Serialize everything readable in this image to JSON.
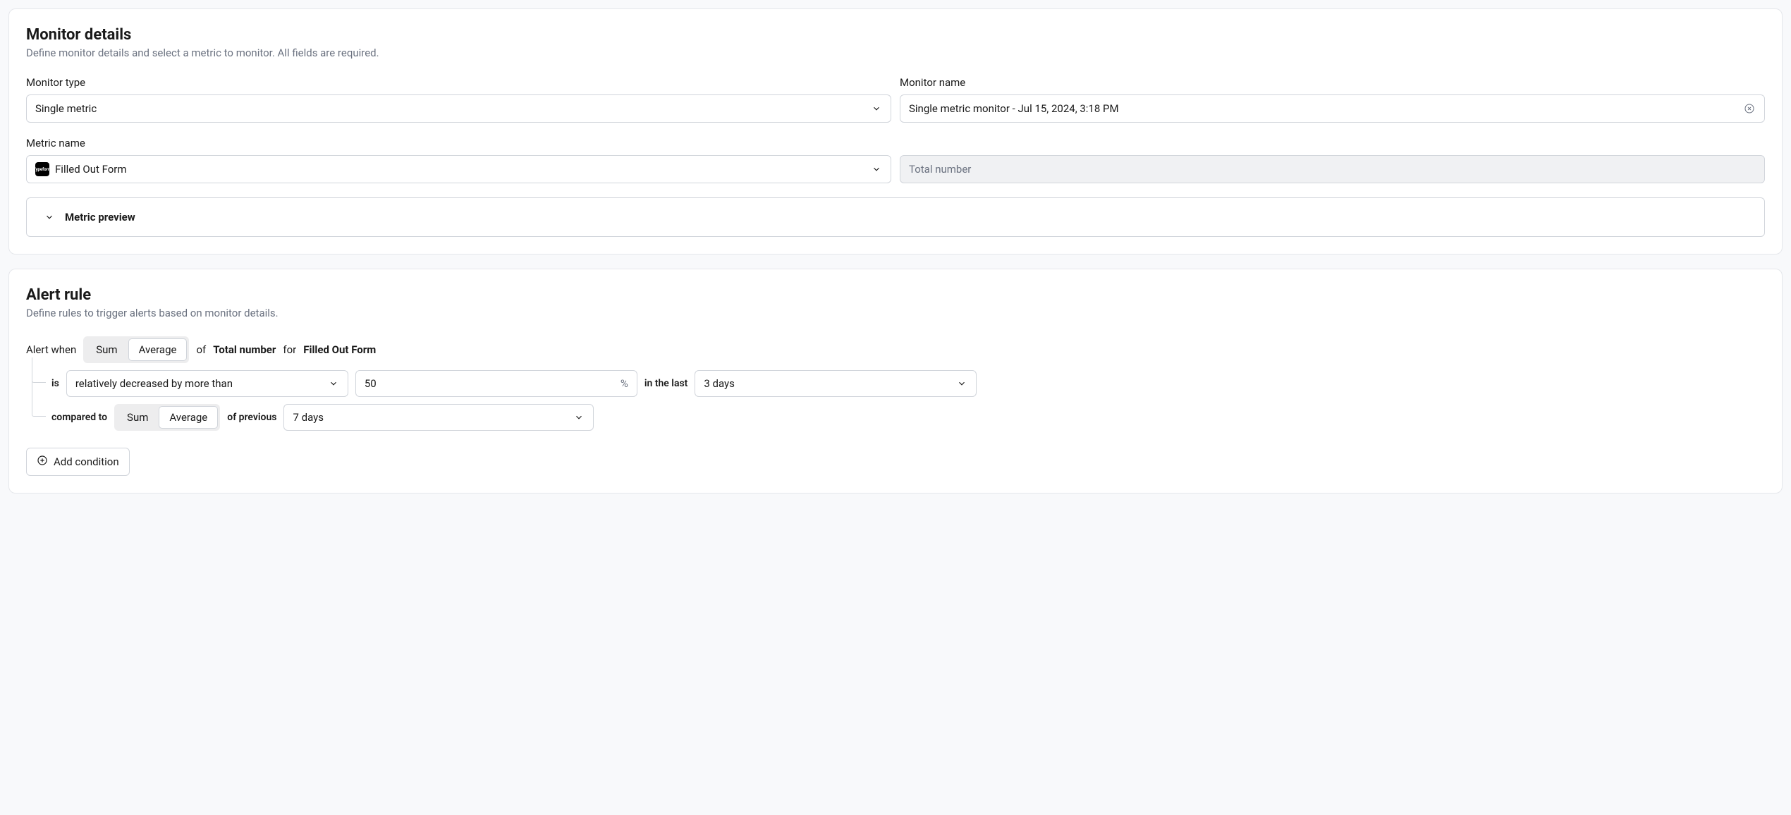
{
  "monitor_details": {
    "title": "Monitor details",
    "desc": "Define monitor details and select a metric to monitor. All fields are required.",
    "monitor_type_label": "Monitor type",
    "monitor_type_value": "Single metric",
    "monitor_name_label": "Monitor name",
    "monitor_name_value": "Single metric monitor - Jul 15, 2024, 3:18 PM",
    "metric_name_label": "Metric name",
    "metric_name_value": "Filled Out Form",
    "metric_agg_value": "Total number",
    "metric_preview_label": "Metric preview"
  },
  "alert_rule": {
    "title": "Alert rule",
    "desc": "Define rules to trigger alerts based on monitor details.",
    "alert_when": "Alert when",
    "seg1_sum": "Sum",
    "seg1_avg": "Average",
    "of": "of",
    "metric_agg": "Total number",
    "for": "for",
    "metric_name": "Filled Out Form",
    "is": "is",
    "comparison": "relatively decreased by more than",
    "threshold": "50",
    "threshold_unit": "%",
    "in_last": "in the last",
    "period": "3 days",
    "compared_to": "compared to",
    "seg2_sum": "Sum",
    "seg2_avg": "Average",
    "of_previous": "of previous",
    "prev_period": "7 days",
    "add_condition": "Add condition"
  }
}
